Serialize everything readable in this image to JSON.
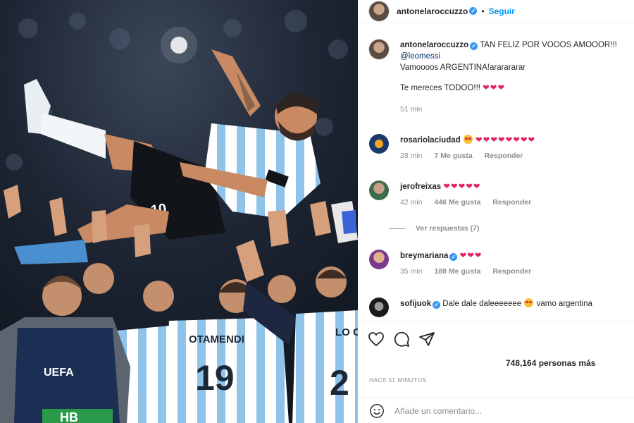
{
  "header": {
    "username": "antonelaroccuzzo",
    "separator": "•",
    "follow_label": "Seguir"
  },
  "photo": {
    "jersey_names": [
      "OTAMENDI",
      "LO C"
    ],
    "jersey_numbers": [
      "19",
      "2"
    ],
    "player_number": "10",
    "bib_brand": "UEFA",
    "bib_code": "HB"
  },
  "caption": {
    "username": "antonelaroccuzzo",
    "text_line1": "TAN FELIZ POR VOOOS AMOOOR!!!",
    "mention": "@leomessi",
    "text_line3": "Vamoooos ARGENTINA!ararararar",
    "text_line4": "Te mereces TODOO!!!",
    "hearts": "❤❤❤",
    "time": "51 min"
  },
  "comments": [
    {
      "username": "rosariolaciudad",
      "verified": false,
      "hearts": "❤❤❤❤❤❤❤❤",
      "has_emoji": true,
      "time": "28 min",
      "likes": "7 Me gusta",
      "reply": "Responder"
    },
    {
      "username": "jerofreixas",
      "verified": false,
      "hearts": "❤❤❤❤❤",
      "has_emoji": false,
      "time": "42 min",
      "likes": "446 Me gusta",
      "reply": "Responder"
    },
    {
      "username": "breymariana",
      "verified": true,
      "hearts": "❤❤❤",
      "has_emoji": false,
      "time": "35 min",
      "likes": "188 Me gusta",
      "reply": "Responder"
    },
    {
      "username": "sofijuok",
      "verified": true,
      "text_before": "Dale dale daleeeeeee",
      "text_after": "vamo argentina"
    }
  ],
  "view_replies": "Ver respuestas (7)",
  "likes_text": "748,164 personas más",
  "timestamp": "HACE 51 MINUTOS",
  "add_comment_placeholder": "Añade un comentario...",
  "colors": {
    "accent": "#0095f6",
    "verified": "#3897f0",
    "heart": "#e0245e",
    "muted": "#8e8e8e"
  }
}
